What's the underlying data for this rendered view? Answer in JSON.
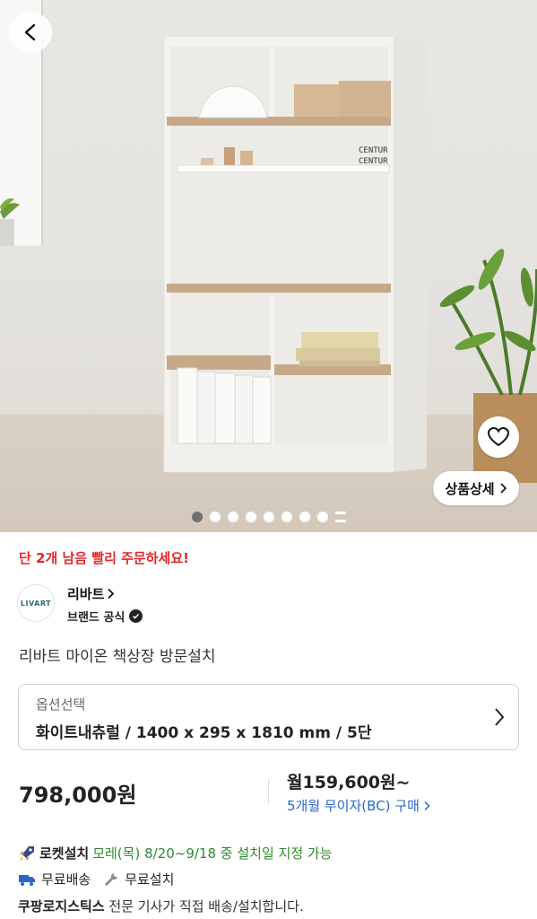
{
  "nav": {
    "back_icon": "chevron-left-icon"
  },
  "gallery": {
    "image_description": "White bookshelf with wood-tone shelves in a room",
    "heart_icon": "heart-outline-icon",
    "detail_button_label": "상품상세",
    "total_dots": 8,
    "active_index": 0
  },
  "stock_notice": "단 2개 남음 빨리 주문하세요!",
  "brand": {
    "logo_text": "LIVART",
    "name": "리바트",
    "official_label": "브랜드 공식"
  },
  "product": {
    "title": "리바트 마이온 책상장 방문설치"
  },
  "option": {
    "label": "옵션선택",
    "value": "화이트내츄럴 / 1400 x 295 x 1810 mm / 5단"
  },
  "price": {
    "amount": "798,000원",
    "monthly": "월159,600원~",
    "installment": "5개월 무이자(BC) 구매"
  },
  "delivery": {
    "rocket_title": "로켓설치",
    "rocket_desc": "모레(목) 8/20~9/18 중 설치일 지정 가능",
    "free_shipping": "무료배송",
    "free_install": "무료설치",
    "logistics_name": "쿠팡로지스틱스",
    "logistics_desc": "전문 기사가 직접 배송/설치합니다."
  },
  "colors": {
    "accent_red": "#e52528",
    "link_blue": "#2a66c8",
    "green": "#2e8b2e"
  }
}
